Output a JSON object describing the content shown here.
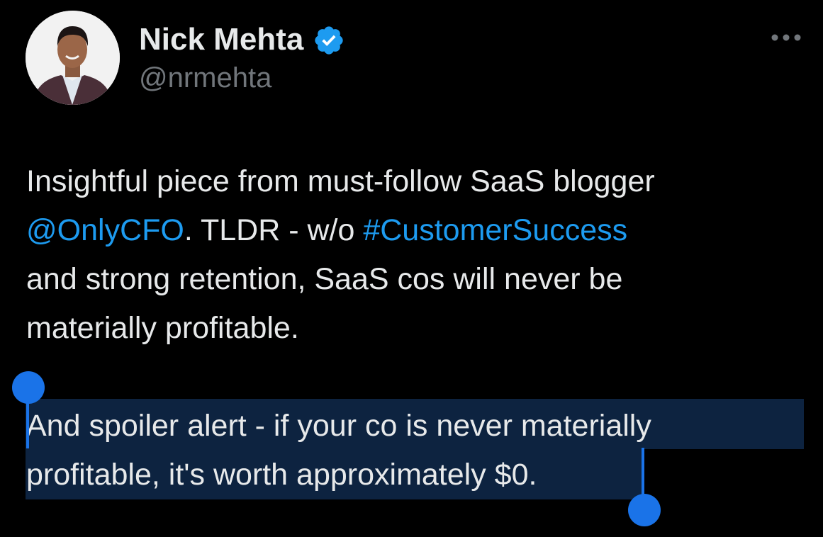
{
  "author": {
    "display_name": "Nick Mehta",
    "handle": "@nrmehta",
    "verified": true,
    "avatar_icon": "profile-photo"
  },
  "more_menu_icon": "more-horizontal-icon",
  "tweet": {
    "lines": [
      [
        {
          "text": "Insightful piece from must-follow SaaS blogger",
          "link": false
        }
      ],
      [
        {
          "text": "@OnlyCFO",
          "link": true
        },
        {
          "text": ". TLDR - w/o ",
          "link": false
        },
        {
          "text": "#CustomerSuccess",
          "link": true
        }
      ],
      [
        {
          "text": "and strong retention, SaaS cos will never be",
          "link": false
        }
      ],
      [
        {
          "text": "materially profitable.",
          "link": false
        }
      ]
    ],
    "selected_lines": [
      "And spoiler alert - if your co is never materially",
      "profitable, it's worth approximately $0."
    ]
  },
  "colors": {
    "background": "#000000",
    "text": "#e7e9ea",
    "secondary": "#71767b",
    "link": "#1d9bf0",
    "verified": "#1d9bf0",
    "selection": "#0d2340",
    "selection_handle": "#1a73e8"
  }
}
